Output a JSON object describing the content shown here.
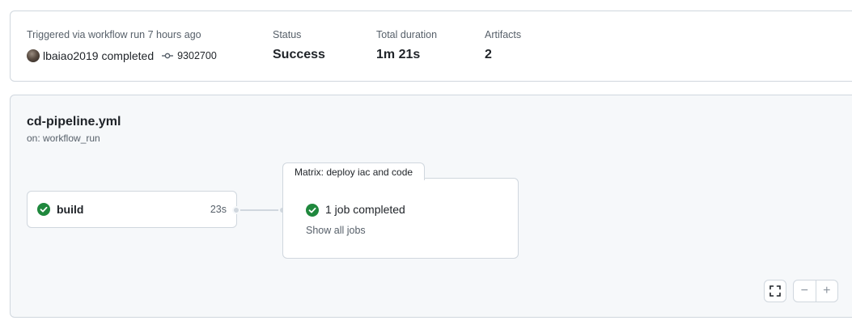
{
  "summary": {
    "trigger_label": "Triggered via workflow run 7 hours ago",
    "actor": "lbaiao2019",
    "action": "completed",
    "commit_sha": "9302700",
    "status_label": "Status",
    "status_value": "Success",
    "duration_label": "Total duration",
    "duration_value": "1m 21s",
    "artifacts_label": "Artifacts",
    "artifacts_value": "2"
  },
  "workflow": {
    "file": "cd-pipeline.yml",
    "trigger": "on: workflow_run"
  },
  "jobs": [
    {
      "name": "build",
      "duration": "23s",
      "status": "success"
    }
  ],
  "matrix": {
    "title": "Matrix: deploy iac and code",
    "status_text": "1 job completed",
    "show_all": "Show all jobs"
  },
  "controls": {
    "fullscreen_icon": "fullscreen-icon",
    "zoom_out": "−",
    "zoom_in": "+"
  },
  "colors": {
    "success": "#1f883d",
    "border": "#d0d7de",
    "muted_text": "#57606a"
  }
}
